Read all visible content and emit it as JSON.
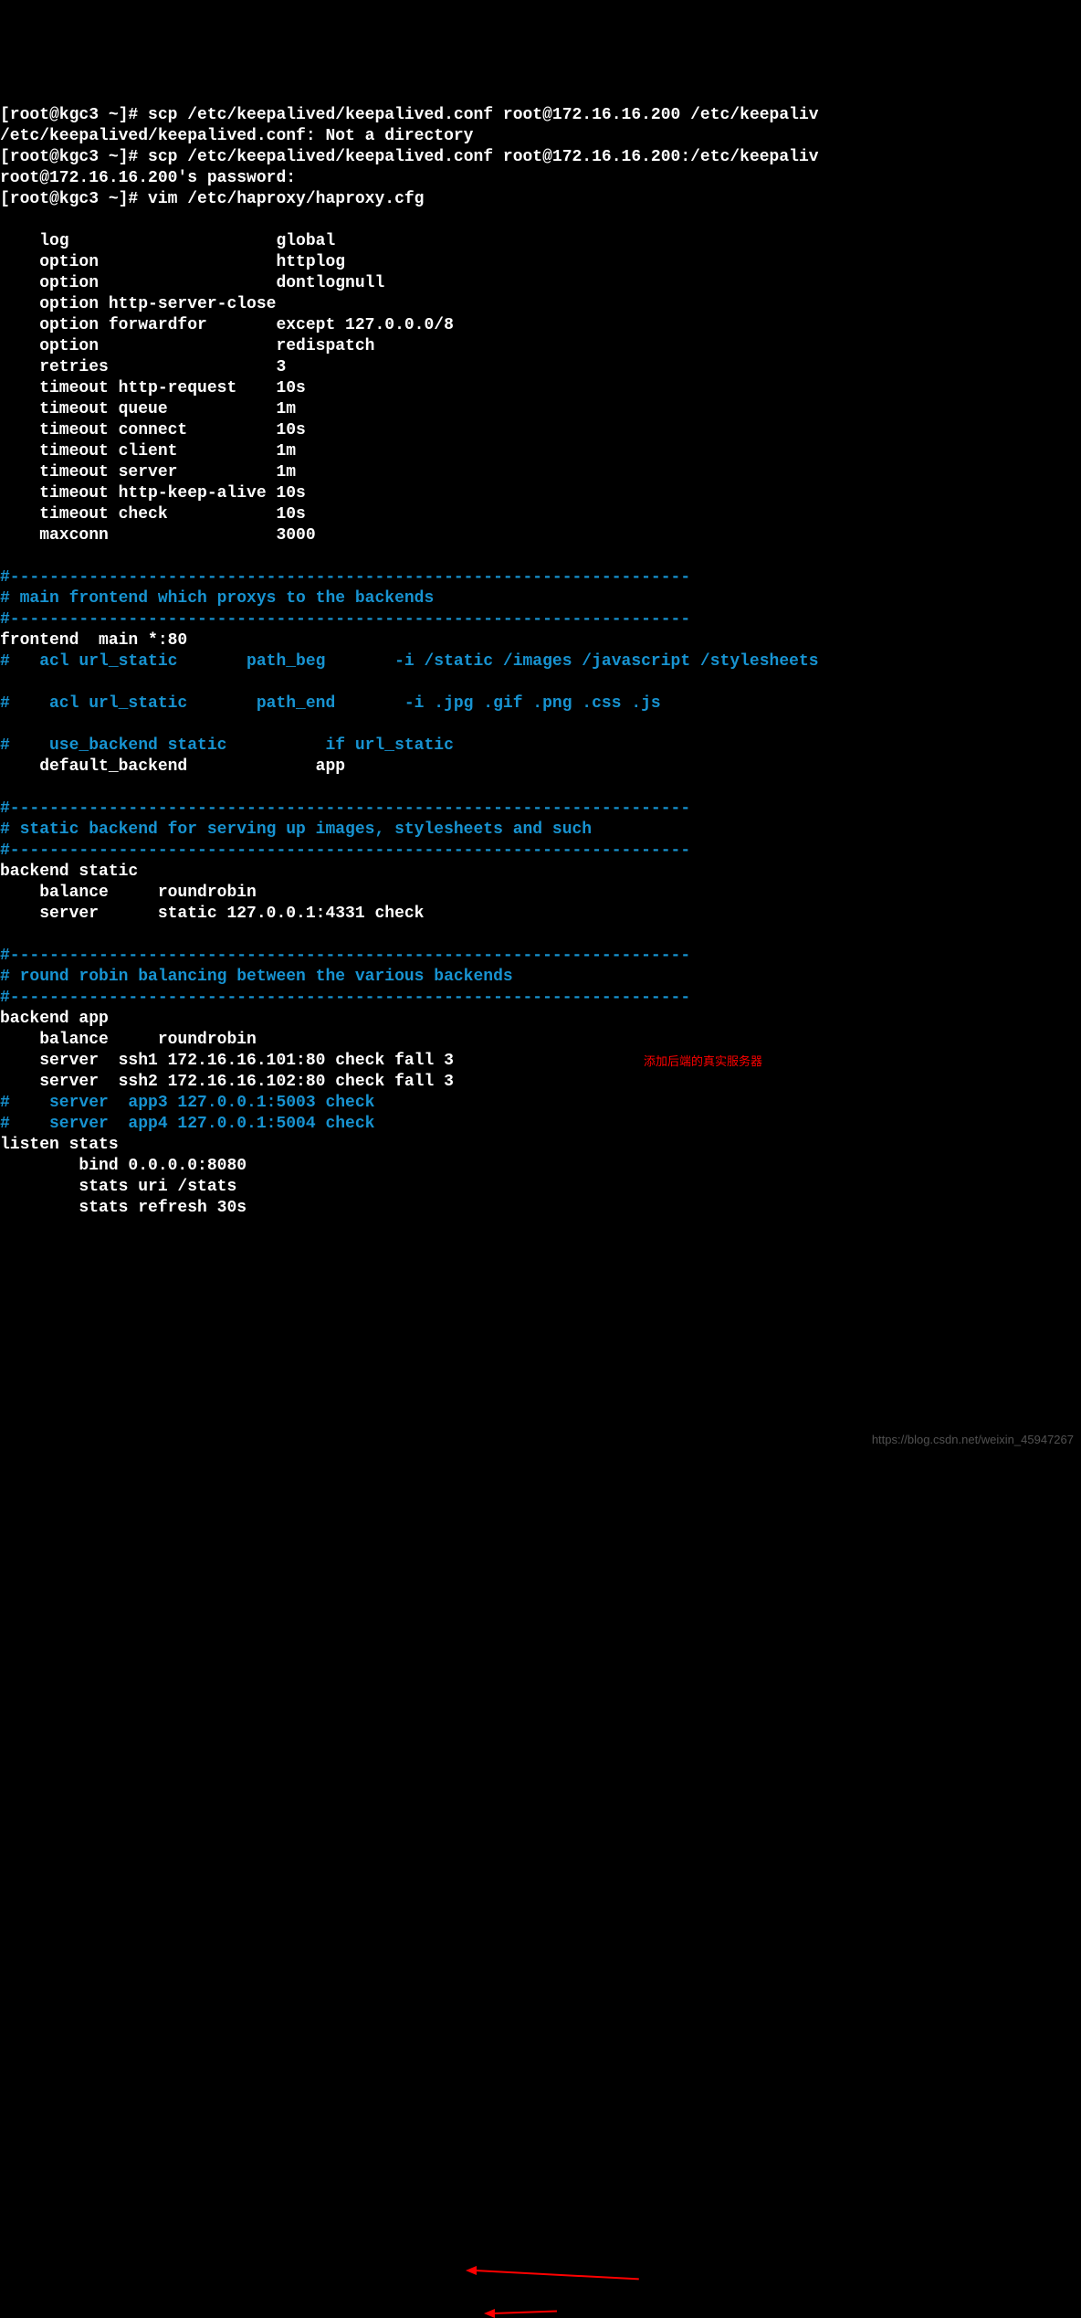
{
  "shell": {
    "line1_prompt": "[root@kgc3 ~]# ",
    "line1_cmd": "scp /etc/keepalived/keepalived.conf root@172.16.16.200 /etc/keepaliv",
    "line2": "/etc/keepalived/keepalived.conf: Not a directory",
    "line3_prompt": "[root@kgc3 ~]# ",
    "line3_cmd": "scp /etc/keepalived/keepalived.conf root@172.16.16.200:/etc/keepaliv",
    "line4": "root@172.16.16.200's password:",
    "line5_prompt": "[root@kgc3 ~]# ",
    "line5_cmd": "vim /etc/haproxy/haproxy.cfg"
  },
  "cfg": {
    "d1": "    log                     global",
    "d2": "    option                  httplog",
    "d3": "    option                  dontlognull",
    "d4": "    option http-server-close",
    "d5": "    option forwardfor       except 127.0.0.0/8",
    "d6": "    option                  redispatch",
    "d7": "    retries                 3",
    "d8": "    timeout http-request    10s",
    "d9": "    timeout queue           1m",
    "d10": "    timeout connect         10s",
    "d11": "    timeout client          1m",
    "d12": "    timeout server          1m",
    "d13": "    timeout http-keep-alive 10s",
    "d14": "    timeout check           10s",
    "d15": "    maxconn                 3000",
    "sep1a": "#---------------------------------------------------------------------",
    "sep1b": "# main frontend which proxys to the backends",
    "sep1c": "#---------------------------------------------------------------------",
    "fe1": "frontend  main *:80",
    "fe2": "#   acl url_static       path_beg       -i /static /images /javascript /stylesheets",
    "fe3": "#    acl url_static       path_end       -i .jpg .gif .png .css .js",
    "fe4": "#    use_backend static          if url_static",
    "fe5": "    default_backend             app",
    "sep2a": "#---------------------------------------------------------------------",
    "sep2b": "# static backend for serving up images, stylesheets and such",
    "sep2c": "#---------------------------------------------------------------------",
    "bs1": "backend static",
    "bs2": "    balance     roundrobin",
    "bs3": "    server      static 127.0.0.1:4331 check",
    "sep3a": "#---------------------------------------------------------------------",
    "sep3b": "# round robin balancing between the various backends",
    "sep3c": "#---------------------------------------------------------------------",
    "ba1": "backend app",
    "ba2": "    balance     roundrobin",
    "ba3": "    server  ssh1 172.16.16.101:80 check fall 3",
    "ba4": "    server  ssh2 172.16.16.102:80 check fall 3",
    "ba5": "#    server  app3 127.0.0.1:5003 check",
    "ba6": "#    server  app4 127.0.0.1:5004 check",
    "ls1": "listen stats",
    "ls2": "        bind 0.0.0.0:8080",
    "ls3": "        stats uri /stats",
    "ls4": "        stats refresh 30s"
  },
  "annotation": {
    "text": "添加后端的真实服务器"
  },
  "watermark": "https://blog.csdn.net/weixin_45947267"
}
